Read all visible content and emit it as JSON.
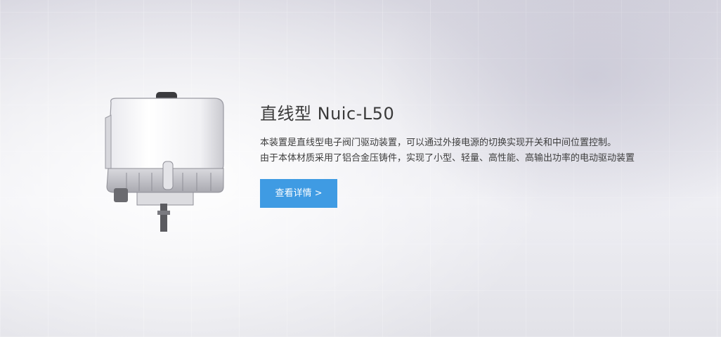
{
  "banner": {
    "product_image": "electric-linear-valve-actuator",
    "title": "直线型 Nuic-L50",
    "description": [
      "本装置是直线型电子阀门驱动装置，可以通过外接电源的切换实现开关和中间位置控制。",
      "由于本体材质采用了铝合金压铸件，实现了小型、轻量、高性能、高输出功率的电动驱动装置"
    ],
    "cta_label": "查看详情 >"
  },
  "colors": {
    "accent": "#3f9be3",
    "title_text": "#3a3a3a",
    "body_text": "#3d3d3d"
  }
}
